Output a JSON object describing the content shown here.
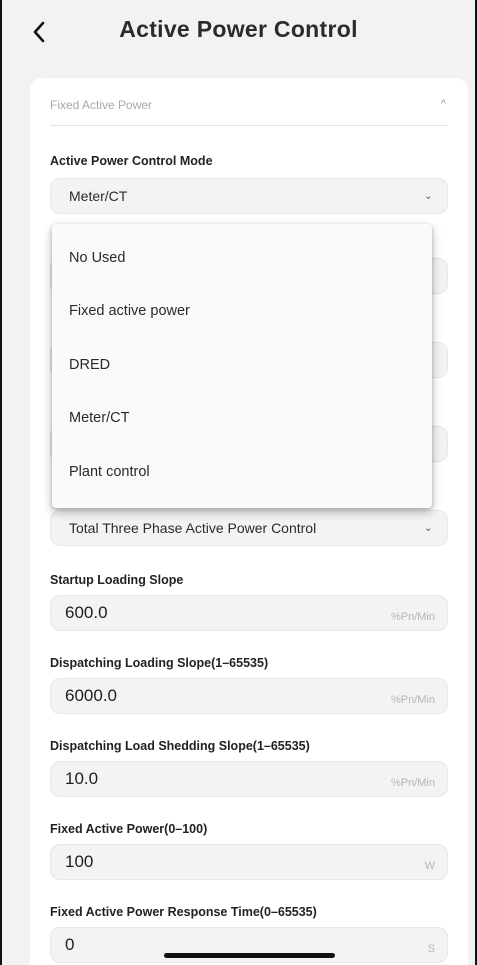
{
  "header": {
    "title": "Active Power Control",
    "back_icon": "chevron-left-icon"
  },
  "section": {
    "title": "Fixed Active Power",
    "chevron": "^"
  },
  "mode": {
    "label": "Active Power Control Mode",
    "value": "Meter/CT",
    "chevron": "⌄"
  },
  "dropdown": {
    "options": [
      "No Used",
      "Fixed active power",
      "DRED",
      "Meter/CT",
      "Plant control"
    ]
  },
  "control_type": {
    "value": "Total Three Phase Active Power Control",
    "chevron": "⌄"
  },
  "fields": [
    {
      "label": "Startup Loading Slope",
      "value": "600.0",
      "unit": "%Pn/Min"
    },
    {
      "label": "Dispatching Loading Slope(1–65535)",
      "value": "6000.0",
      "unit": "%Pn/Min"
    },
    {
      "label": "Dispatching Load Shedding Slope(1–65535)",
      "value": "10.0",
      "unit": "%Pn/Min"
    },
    {
      "label": "Fixed Active Power(0–100)",
      "value": "100",
      "unit": "W"
    },
    {
      "label": "Fixed Active Power Response Time(0–65535)",
      "value": "0",
      "unit": "S"
    }
  ]
}
